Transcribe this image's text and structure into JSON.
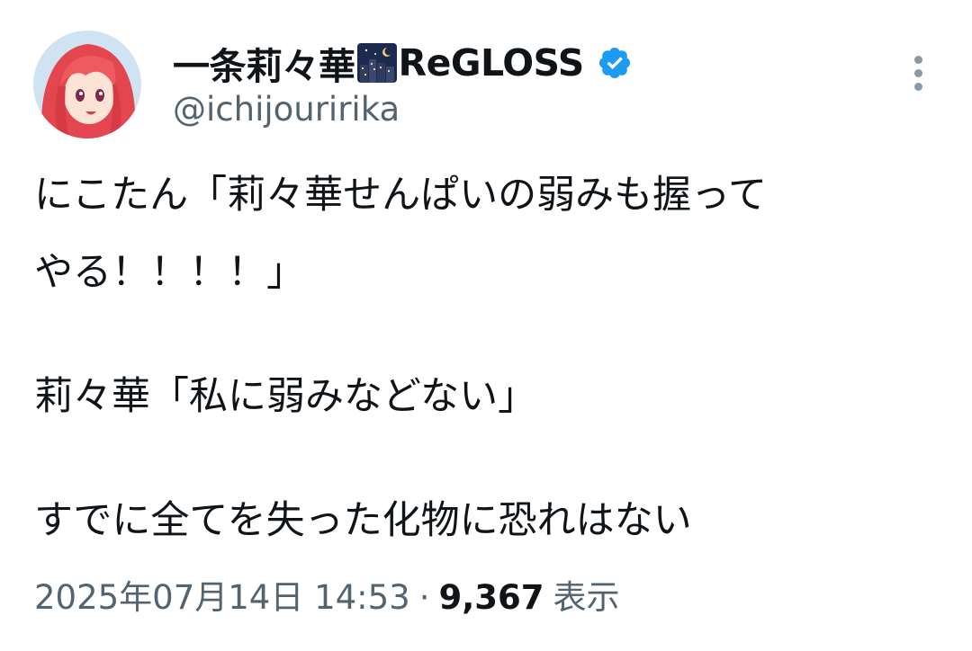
{
  "user": {
    "display_name": "一条莉々華",
    "name_suffix": "ReGLOSS",
    "emoji_icon": "night-city-emoji-icon",
    "verified_icon": "verified-badge-icon",
    "handle": "@ichijouririka",
    "avatar_icon": "avatar-red-haired-anime-girl"
  },
  "tweet": {
    "lines": [
      "にこたん「莉々華せんぱいの弱みも握って",
      "やる！！！！」",
      "莉々華「私に弱みなどない」",
      "すでに全てを失った化物に恐れはない"
    ],
    "timestamp": "2025年07月14日 14:53",
    "separator": "·",
    "views_count": "9,367",
    "views_label": "表示"
  },
  "colors": {
    "text": "#0f1419",
    "secondary": "#536471",
    "verified": "#1d9bf0",
    "more_icon": "#8b98a5"
  },
  "more_icon": "more-vertical-icon"
}
